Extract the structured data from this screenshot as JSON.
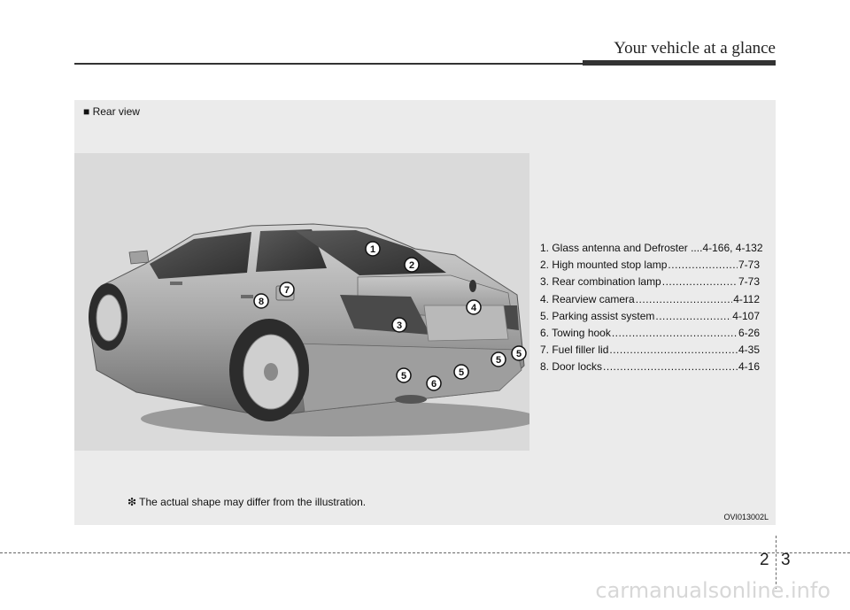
{
  "header": {
    "title": "Your vehicle at a glance"
  },
  "section": {
    "label": "■ Rear view"
  },
  "legend": [
    {
      "label": "1. Glass antenna and Defroster ....",
      "page": "4-166, 4-132"
    },
    {
      "label": "2. High mounted stop lamp",
      "page": "7-73"
    },
    {
      "label": "3. Rear combination lamp",
      "page": "7-73"
    },
    {
      "label": "4. Rearview camera",
      "page": "4-112"
    },
    {
      "label": "5. Parking assist system",
      "page": "4-107"
    },
    {
      "label": "6. Towing hook",
      "page": "6-26"
    },
    {
      "label": "7. Fuel filler lid",
      "page": "4-35"
    },
    {
      "label": "8. Door locks",
      "page": "4-16"
    }
  ],
  "callouts": [
    "1",
    "2",
    "3",
    "4",
    "5",
    "5",
    "5",
    "5",
    "6",
    "7",
    "8"
  ],
  "note": "❇ The actual shape may differ from the illustration.",
  "figure_code": "OVI013002L",
  "page": {
    "chapter": "2",
    "number": "3"
  },
  "watermark": "carmanualsonline.info"
}
